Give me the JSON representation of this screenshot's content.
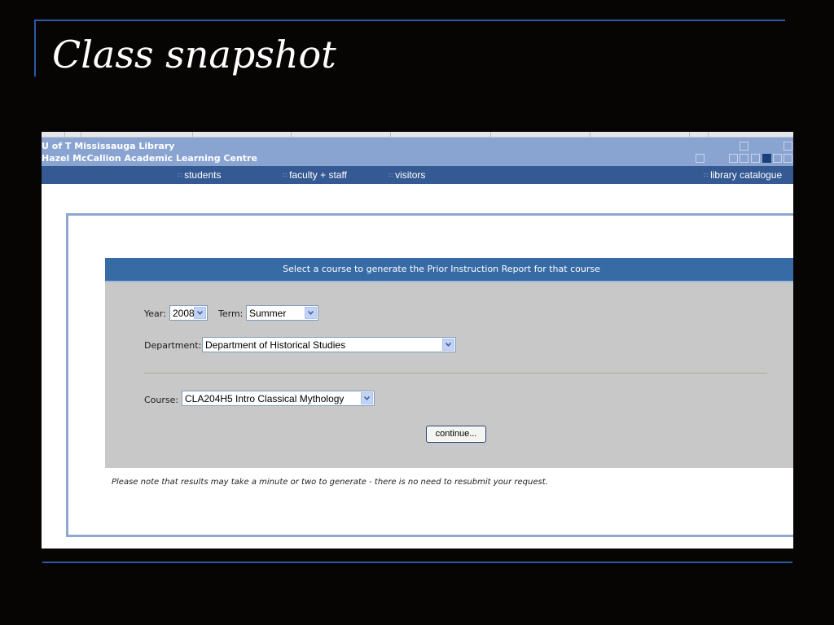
{
  "slide": {
    "title": "Class snapshot"
  },
  "library": {
    "name_line1": "U of T Mississauga Library",
    "name_line2": "Hazel McCallion Academic Learning Centre"
  },
  "nav": {
    "items": [
      {
        "label": "students"
      },
      {
        "label": "faculty + staff"
      },
      {
        "label": "visitors"
      },
      {
        "label": "library catalogue"
      }
    ]
  },
  "form": {
    "header": "Select a course to generate the Prior Instruction Report for that course",
    "year_label": "Year:",
    "year_value": "2008",
    "term_label": "Term:",
    "term_value": "Summer",
    "department_label": "Department:",
    "department_value": "Department of Historical Studies",
    "course_label": "Course:",
    "course_value": "CLA204H5 Intro Classical Mythology",
    "continue_label": "continue..."
  },
  "note": "Please note that results may take a minute or two to generate - there is no need to resubmit your request.",
  "colors": {
    "slide_background": "#070404",
    "rule_blue": "#2d5aa7",
    "header_blue": "#8aa4d2",
    "nav_blue": "#355a93",
    "form_header_blue": "#376ba6",
    "form_panel_gray": "#c8c8c8"
  },
  "icons": {
    "dropdown": "chevron-down-icon",
    "nav_bullet": "grid-dots-icon"
  }
}
